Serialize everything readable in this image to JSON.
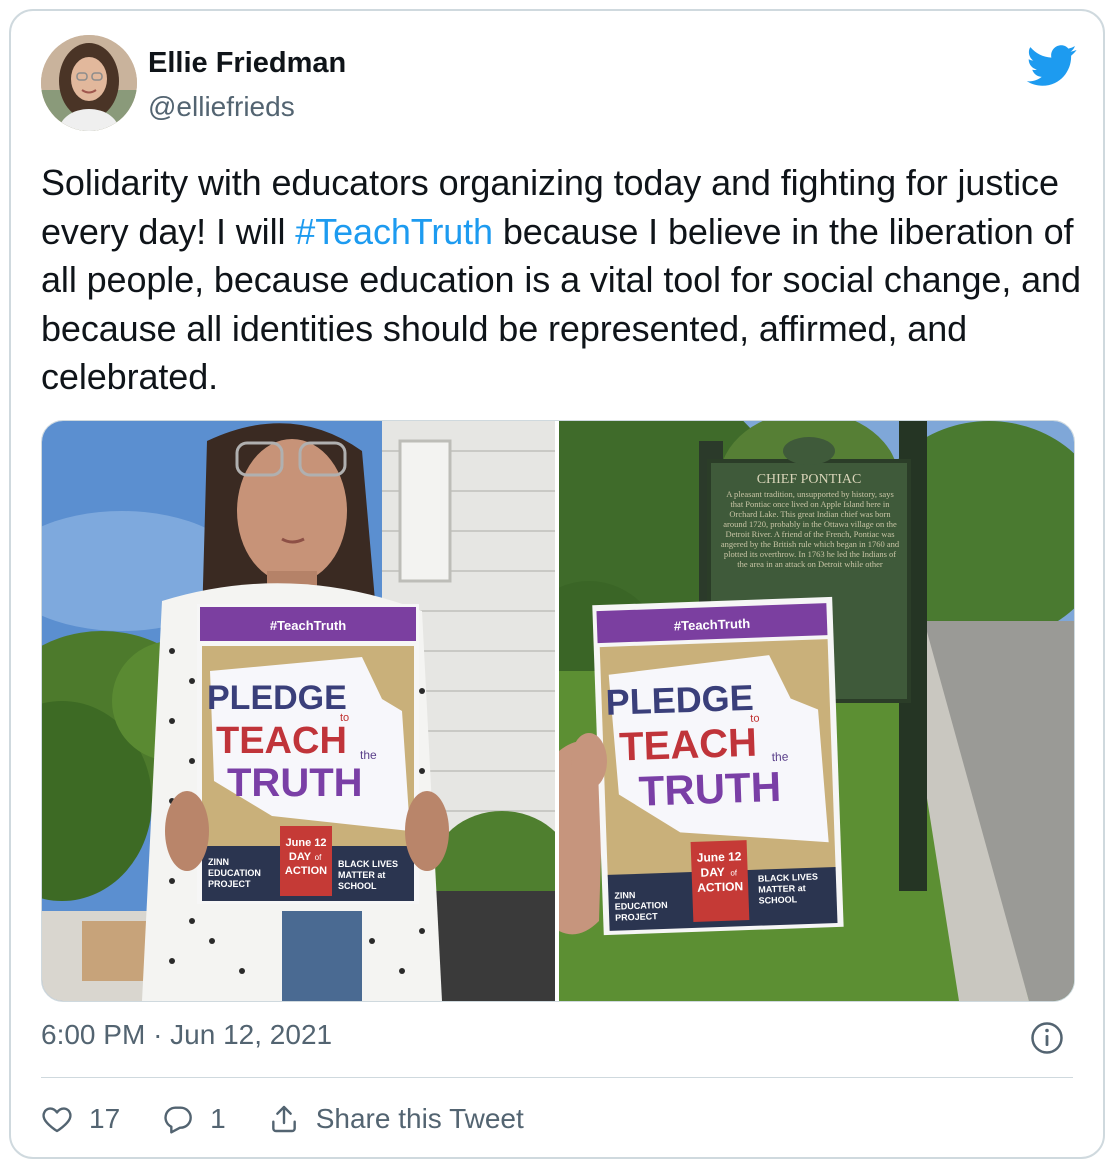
{
  "author": {
    "name": "Ellie Friedman",
    "handle": "@elliefrieds"
  },
  "tweet": {
    "text_before": "Solidarity with educators organizing today and fighting for justice every day! I will ",
    "hashtag": "#TeachTruth",
    "text_after": " because I believe in the liberation of all people, because education is a vital tool for social change, and because all identities should be represented, affirmed, and celebrated."
  },
  "media": {
    "photo_left": {
      "poster_hashtag": "#TeachTruth",
      "poster_pledge": "PLEDGE",
      "poster_to": "to",
      "poster_teach": "TEACH",
      "poster_the": "the",
      "poster_truth": "TRUTH",
      "poster_date": "June 12",
      "poster_day": "DAY",
      "poster_of": "of",
      "poster_action": "ACTION",
      "poster_zinn": "ZINN",
      "poster_education": "EDUCATION",
      "poster_project": "PROJECT",
      "poster_blm1": "BLACK LIVES",
      "poster_blm2": "MATTER at",
      "poster_blm3": "SCHOOL"
    },
    "photo_right": {
      "sign_title": "CHIEF PONTIAC",
      "sign_text": "A pleasant tradition, unsupported by history, says that Pontiac once lived on Apple Island here in Orchard Lake. This great Indian chief was born around 1720, probably in the Ottawa village on the Detroit River. A friend of the French, Pontiac was angered by the British rule which began in 1760 and plotted its overthrow. In 1763 he led the Indians of the area in an attack on Detroit while other",
      "poster_hashtag": "#TeachTruth",
      "poster_pledge": "PLEDGE",
      "poster_to": "to",
      "poster_teach": "TEACH",
      "poster_the": "the",
      "poster_truth": "TRUTH",
      "poster_date": "June 12",
      "poster_day": "DAY",
      "poster_of": "of",
      "poster_action": "ACTION",
      "poster_zinn": "ZINN",
      "poster_education": "EDUCATION",
      "poster_project": "PROJECT",
      "poster_blm1": "BLACK LIVES",
      "poster_blm2": "MATTER at",
      "poster_blm3": "SCHOOL"
    }
  },
  "meta": {
    "time": "6:00 PM",
    "separator": "·",
    "date": "Jun 12, 2021"
  },
  "actions": {
    "likes": "17",
    "replies": "1",
    "share_label": "Share this Tweet"
  },
  "colors": {
    "brand": "#1d9bf0",
    "text": "#0f1419",
    "secondary": "#536471",
    "border": "#cfd9de"
  },
  "icons": [
    "twitter-bird-icon",
    "info-icon",
    "heart-icon",
    "reply-icon",
    "share-icon"
  ]
}
